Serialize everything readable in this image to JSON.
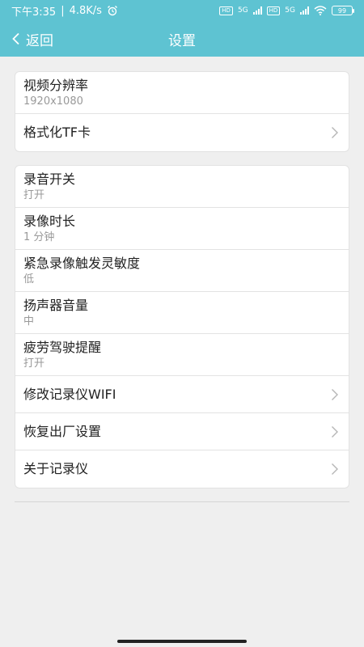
{
  "status_bar": {
    "time": "下午3:35",
    "speed": "4.8K/s",
    "battery": "99",
    "net1": "5G",
    "net2": "5G",
    "hd1": "HD",
    "hd2": "HD"
  },
  "header": {
    "back_label": "返回",
    "title": "设置"
  },
  "group1": [
    {
      "label": "视频分辨率",
      "value": "1920x1080"
    },
    {
      "label": "格式化TF卡"
    }
  ],
  "group2": [
    {
      "label": "录音开关",
      "value": "打开"
    },
    {
      "label": "录像时长",
      "value": "1 分钟"
    },
    {
      "label": "紧急录像触发灵敏度",
      "value": "低"
    },
    {
      "label": "扬声器音量",
      "value": "中"
    },
    {
      "label": "疲劳驾驶提醒",
      "value": "打开"
    },
    {
      "label": "修改记录仪WIFI"
    },
    {
      "label": "恢复出厂设置"
    },
    {
      "label": "关于记录仪"
    }
  ],
  "colors": {
    "accent": "#5ec3d2",
    "background": "#efefef",
    "chevron": "#b5b5b5"
  }
}
